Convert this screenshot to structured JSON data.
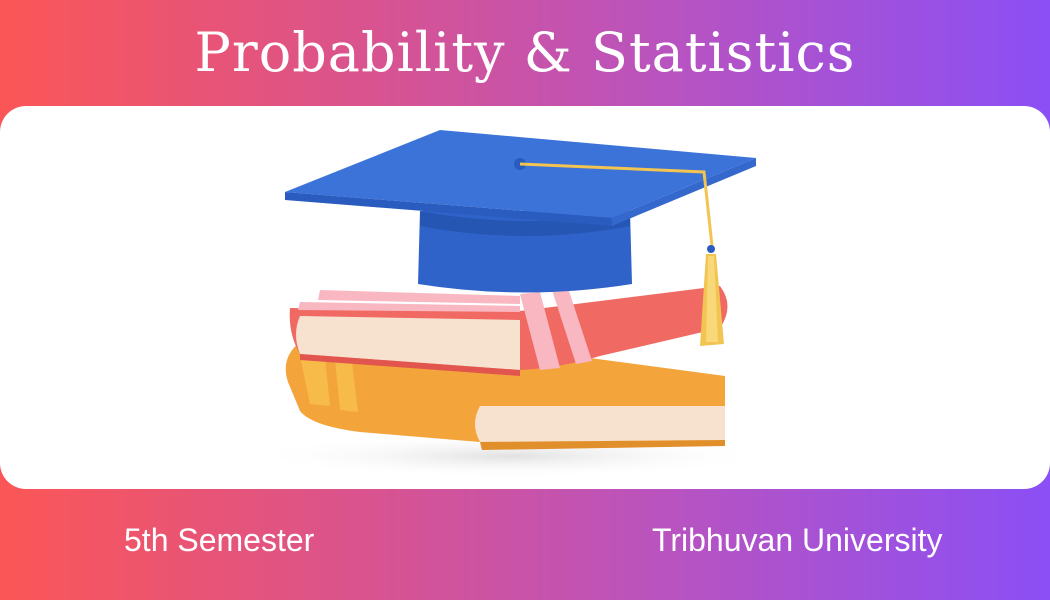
{
  "title": "Probability & Statistics",
  "illustration": {
    "icon": "graduation-cap-on-books",
    "colors": {
      "cap": "#3b73d8",
      "tassel": "#f2c451",
      "top_book": "#f06a63",
      "bottom_book": "#f3a43a",
      "pages": "#f7e2cf"
    }
  },
  "footer": {
    "semester": "5th Semester",
    "university": "Tribhuvan University"
  }
}
